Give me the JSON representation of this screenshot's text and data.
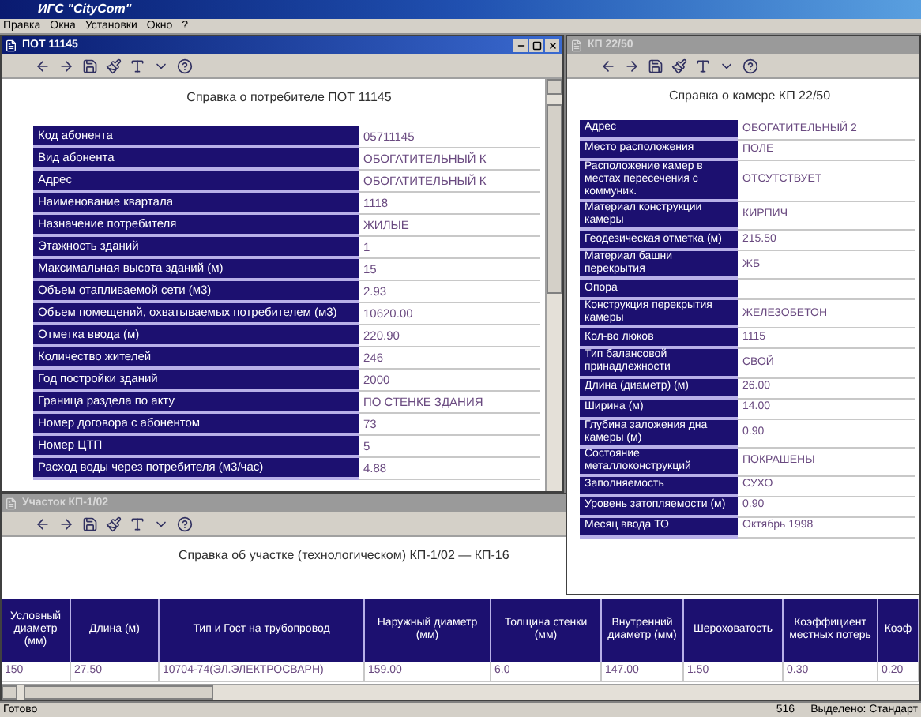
{
  "app": {
    "title": "ИГС \"CityCom\""
  },
  "menu": [
    "Правка",
    "Окна",
    "Установки",
    "Окно",
    "?"
  ],
  "consumer_window": {
    "title": "ПОТ 11145",
    "active": true,
    "heading": "Справка о потребителе ПОТ 11145",
    "rows": [
      {
        "label": "Код абонента",
        "value": "05711145"
      },
      {
        "label": "Вид абонента",
        "value": "ОБОГАТИТЕЛЬНЫЙ К"
      },
      {
        "label": "Адрес",
        "value": "ОБОГАТИТЕЛЬНЫЙ К"
      },
      {
        "label": "Наименование квартала",
        "value": "1118"
      },
      {
        "label": "Назначение потребителя",
        "value": "ЖИЛЫЕ"
      },
      {
        "label": "Этажность зданий",
        "value": "1"
      },
      {
        "label": "Максимальная высота зданий (м)",
        "value": "15"
      },
      {
        "label": "Объем отапливаемой сети (м3)",
        "value": "2.93"
      },
      {
        "label": "Объем помещений, охватываемых потребителем (м3)",
        "value": "10620.00"
      },
      {
        "label": "Отметка ввода (м)",
        "value": "220.90"
      },
      {
        "label": "Количество жителей",
        "value": "246"
      },
      {
        "label": "Год постройки зданий",
        "value": "2000"
      },
      {
        "label": "Граница раздела по акту",
        "value": "ПО СТЕНКЕ ЗДАНИЯ"
      },
      {
        "label": "Номер договора с абонентом",
        "value": "73"
      },
      {
        "label": "Номер ЦТП",
        "value": "5"
      },
      {
        "label": "Расход воды через потребителя (м3/час)",
        "value": "4.88"
      }
    ]
  },
  "chamber_window": {
    "title": "КП 22/50",
    "active": false,
    "heading": "Справка о камере КП 22/50",
    "rows": [
      {
        "label": "Адрес",
        "value": "ОБОГАТИТЕЛЬНЫЙ 2"
      },
      {
        "label": "Место расположения",
        "value": "ПОЛЕ"
      },
      {
        "label": "Расположение камер в местах пересечения с коммуник.",
        "value": "ОТСУТСТВУЕТ"
      },
      {
        "label": "Материал конструкции камеры",
        "value": "КИРПИЧ"
      },
      {
        "label": "Геодезическая отметка (м)",
        "value": "215.50"
      },
      {
        "label": "Материал башни перекрытия",
        "value": "ЖБ"
      },
      {
        "label": "Опора"
      },
      {
        "label": "Конструкция перекрытия камеры",
        "value": "ЖЕЛЕЗОБЕТОН"
      },
      {
        "label": "Кол-во люков",
        "value": "1115"
      },
      {
        "label": "Тип балансовой принадлежности",
        "value": "СВОЙ"
      },
      {
        "label": "Длина (диаметр) (м)",
        "value": "26.00"
      },
      {
        "label": "Ширина (м)",
        "value": "14.00"
      },
      {
        "label": "Глубина заложения дна камеры (м)",
        "value": "0.90"
      },
      {
        "label": "Состояние металлоконструкций",
        "value": "ПОКРАШЕНЫ"
      },
      {
        "label": "Заполняемость",
        "value": "СУХО"
      },
      {
        "label": "Уровень затопляемости (м)",
        "value": "0.90"
      },
      {
        "label": "Месяц ввода ТО",
        "value": "Октябрь 1998"
      }
    ]
  },
  "section_window": {
    "title": "Участок КП-1/02",
    "active": false,
    "heading": "Справка об участке (технологическом) КП-1/02 — КП-16",
    "table": {
      "columns": [
        "Условный диаметр (мм)",
        "Длина (м)",
        "Тип и Гост на трубопровод",
        "Наружный диаметр (мм)",
        "Толщина стенки (мм)",
        "Внутренний диаметр (мм)",
        "Шероховатость",
        "Коэффициент местных потерь",
        "Коэф"
      ],
      "rows": [
        [
          "150",
          "27.50",
          "10704-74(ЭЛ.ЭЛЕКТРОСВАРН)",
          "159.00",
          "6.0",
          "147.00",
          "1.50",
          "0.30",
          "0.20"
        ]
      ]
    }
  },
  "status_bar": [
    "Готово",
    "516",
    "Выделено: Стандарт"
  ]
}
